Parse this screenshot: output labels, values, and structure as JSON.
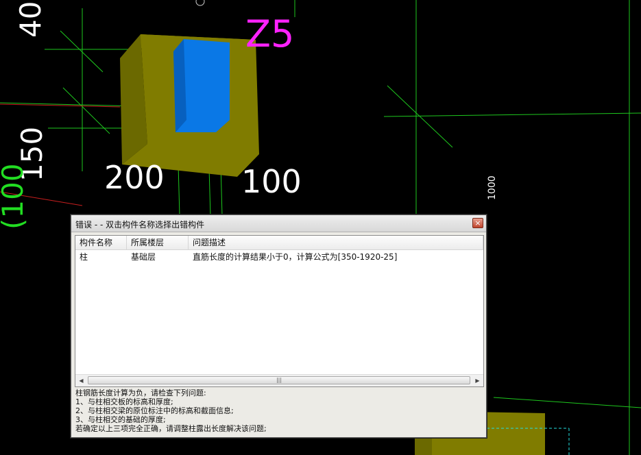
{
  "viewport": {
    "dim_40": "40",
    "dim_z5": "Z5",
    "dim_150": "150",
    "dim_200": "200",
    "dim_100": "100",
    "dim_1000": "1000",
    "dim_100_green": "(100",
    "colors": {
      "column": "#7a7a00",
      "core": "#0a78e6",
      "grid": "#22dd22",
      "label": "#ff22ff"
    }
  },
  "dialog": {
    "title": "错误 - - 双击构件名称选择出错构件",
    "close_label": "×",
    "columns": [
      "构件名称",
      "所属楼层",
      "问题描述"
    ],
    "rows": [
      {
        "name": "柱",
        "floor": "基础层",
        "issue": "直筋长度的计算结果小于0，计算公式为[350-1920-25]"
      }
    ],
    "scroll_left": "◀",
    "scroll_right": "▶",
    "scroll_grip": "|||",
    "description": [
      "柱钢筋长度计算为负，请检查下列问题:",
      " 1、与柱相交板的标高和厚度;",
      " 2、与柱相交梁的原位标注中的标高和截面信息;",
      " 3、与柱相交的基础的厚度;",
      "若确定以上三项完全正确，请调整柱露出长度解决该问题;"
    ]
  }
}
